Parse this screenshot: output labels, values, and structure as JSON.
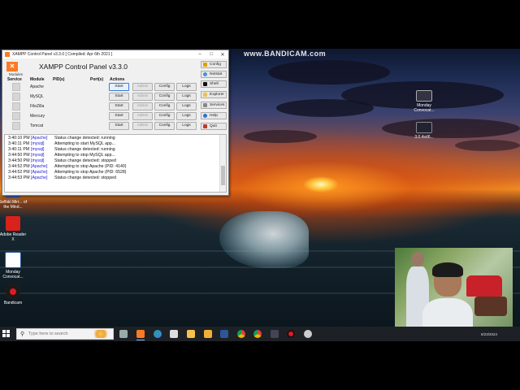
{
  "watermark": "www.BANDICAM.com",
  "xampp": {
    "window_title": "XAMPP Control Panel v3.3.0   [ Compiled: Apr 6th 2021 ]",
    "logo": "✕",
    "heading": "XAMPP Control Panel v3.3.0",
    "modules_label": "Modules",
    "headers": {
      "service": "Service",
      "module": "Module",
      "pids": "PID(s)",
      "ports": "Port(s)",
      "actions": "Actions"
    },
    "modules": [
      {
        "name": "Apache",
        "start": "Start",
        "admin": "Admin",
        "config": "Config",
        "logs": "Logs"
      },
      {
        "name": "MySQL",
        "start": "Start",
        "admin": "Admin",
        "config": "Config",
        "logs": "Logs"
      },
      {
        "name": "FileZilla",
        "start": "Start",
        "admin": "Admin",
        "config": "Config",
        "logs": "Logs"
      },
      {
        "name": "Mercury",
        "start": "Start",
        "admin": "Admin",
        "config": "Config",
        "logs": "Logs"
      },
      {
        "name": "Tomcat",
        "start": "Start",
        "admin": "Admin",
        "config": "Config",
        "logs": "Logs"
      }
    ],
    "side_buttons": [
      "Config",
      "Netstat",
      "Shell",
      "Explorer",
      "Services",
      "Help",
      "Quit"
    ],
    "log": [
      {
        "time": "3:40:10 PM",
        "module": "[Apache]",
        "msg": "Status change detected: running"
      },
      {
        "time": "3:40:11 PM",
        "module": "[mysql]",
        "msg": "Attempting to start MySQL app..."
      },
      {
        "time": "3:40:11 PM",
        "module": "[mysql]",
        "msg": "Status change detected: running"
      },
      {
        "time": "3:44:50 PM",
        "module": "[mysql]",
        "msg": "Attempting to stop MySQL app..."
      },
      {
        "time": "3:44:50 PM",
        "module": "[mysql]",
        "msg": "Status change detected: stopped"
      },
      {
        "time": "3:44:52 PM",
        "module": "[Apache]",
        "msg": "Attempting to stop Apache (PID: 4140)"
      },
      {
        "time": "3:44:52 PM",
        "module": "[Apache]",
        "msg": "Attempting to stop Apache (PID: 6528)"
      },
      {
        "time": "3:44:53 PM",
        "module": "[Apache]",
        "msg": "Status change detected: stopped"
      }
    ]
  },
  "desktop_icons": {
    "monday_top": "Monday Convocat...",
    "second_right": "3.0.4sd6...",
    "selfie": "Selfski Mirr... of the Mind...",
    "adobe": "Adobe Reader X",
    "monday_left": "Monday Convocat...",
    "bandicam": "Bandicam"
  },
  "taskbar": {
    "search_placeholder": "Type here to search",
    "time": "8/23/2024"
  },
  "colors": {
    "xampp_orange": "#fb7a24",
    "taskbar": "#1d2126",
    "log_module": "#1a1ad6"
  }
}
